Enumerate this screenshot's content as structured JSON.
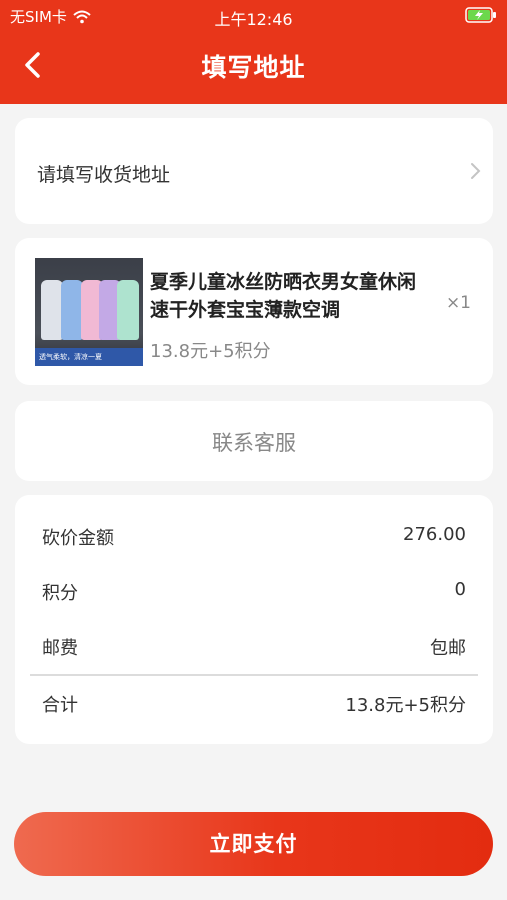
{
  "status_bar": {
    "carrier": "无SIM卡",
    "time": "上午12:46"
  },
  "nav": {
    "title": "填写地址"
  },
  "address": {
    "placeholder": "请填写收货地址"
  },
  "product": {
    "title": "夏季儿童冰丝防晒衣男女童休闲速干外套宝宝薄款空调",
    "price": "13.8元+5积分",
    "quantity": "×1",
    "image_banner": "透气柔软，清凉一夏"
  },
  "service": {
    "label": "联系客服"
  },
  "summary": {
    "rows": [
      {
        "label": "砍价金额",
        "value": "276.00"
      },
      {
        "label": "积分",
        "value": "0"
      },
      {
        "label": "邮费",
        "value": "包邮"
      }
    ],
    "total": {
      "label": "合计",
      "value": "13.8元+5积分"
    }
  },
  "pay_button": {
    "label": "立即支付"
  },
  "colors": {
    "brand": "#e8361a"
  }
}
